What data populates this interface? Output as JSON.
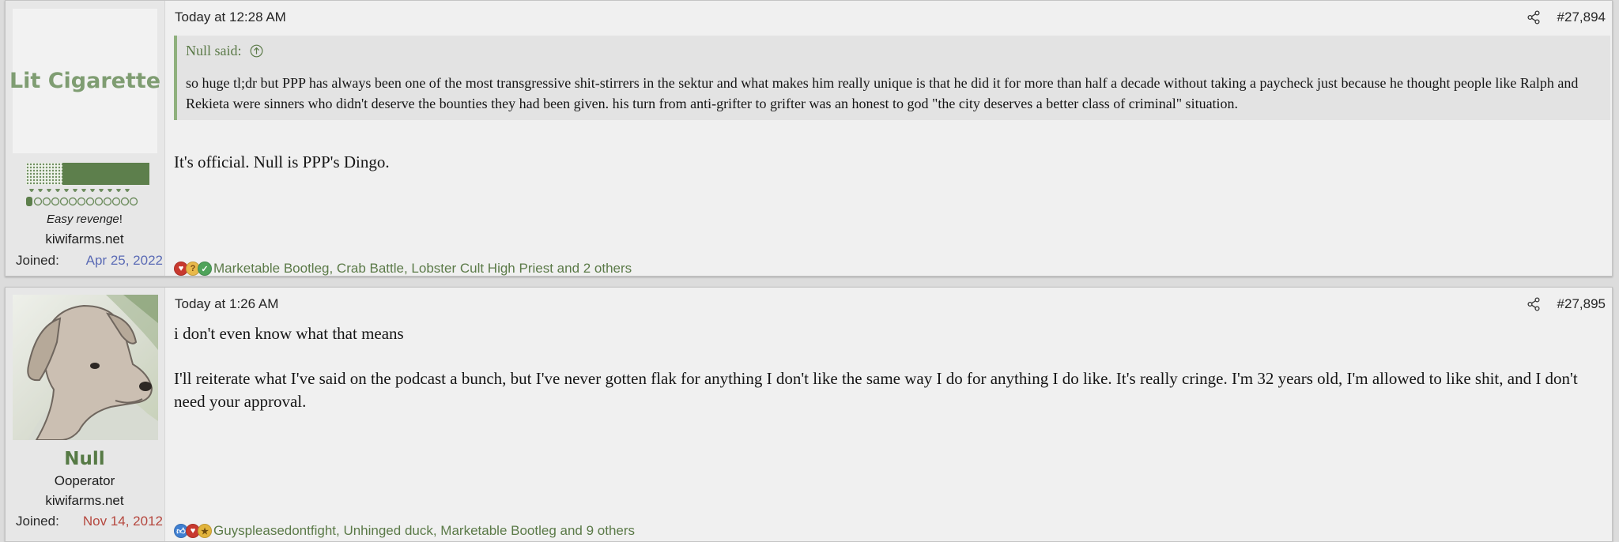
{
  "posts": [
    {
      "user": {
        "avatar_letters": "Lit Cigarette",
        "title": {
          "italic": "Easy revenge",
          "rest": "!"
        },
        "site": "kiwifarms.net",
        "joined_label": "Joined:",
        "joined_date": "Apr 25, 2022",
        "joined_color": "#5b6bb5"
      },
      "date": "Today at 12:28 AM",
      "post_number": "#27,894",
      "quote": {
        "author": "Null said:",
        "text": "so huge tl;dr but PPP has always been one of the most transgressive shit-stirrers in the sektur and what makes him really unique is that he did it for more than half a decade without taking a paycheck just because he thought people like Ralph and Rekieta were sinners who didn't deserve the bounties they had been given. his turn from anti-grifter to grifter was an honest to god \"the city deserves a better class of criminal\" situation."
      },
      "message": [
        "It's official. Null is PPP's Dingo."
      ],
      "reactions": {
        "icons": [
          "heart-reaction-icon",
          "thinking-reaction-icon",
          "check-reaction-icon"
        ],
        "text": "Marketable Bootleg, Crab Battle, Lobster Cult High Priest and 2 others"
      }
    },
    {
      "user": {
        "username": "Null",
        "title": "Ooperator",
        "site": "kiwifarms.net",
        "joined_label": "Joined:",
        "joined_date": "Nov 14, 2012",
        "joined_color": "#b5473e"
      },
      "date": "Today at 1:26 AM",
      "post_number": "#27,895",
      "message": [
        "i don't even know what that means",
        "I'll reiterate what I've said on the podcast a bunch, but I've never gotten flak for anything I don't like the same way I do for anything I do like. It's really cringe. I'm 32 years old, I'm allowed to like shit, and I don't need your approval."
      ],
      "reactions": {
        "icons": [
          "thumbs-up-reaction-icon",
          "heart-reaction-icon",
          "medal-reaction-icon"
        ],
        "text": "Guyspleasedontfight, Unhinged duck, Marketable Bootleg and 9 others"
      }
    }
  ],
  "colors": {
    "accent_green": "#5b7a48",
    "quote_border": "#8fb07d"
  }
}
